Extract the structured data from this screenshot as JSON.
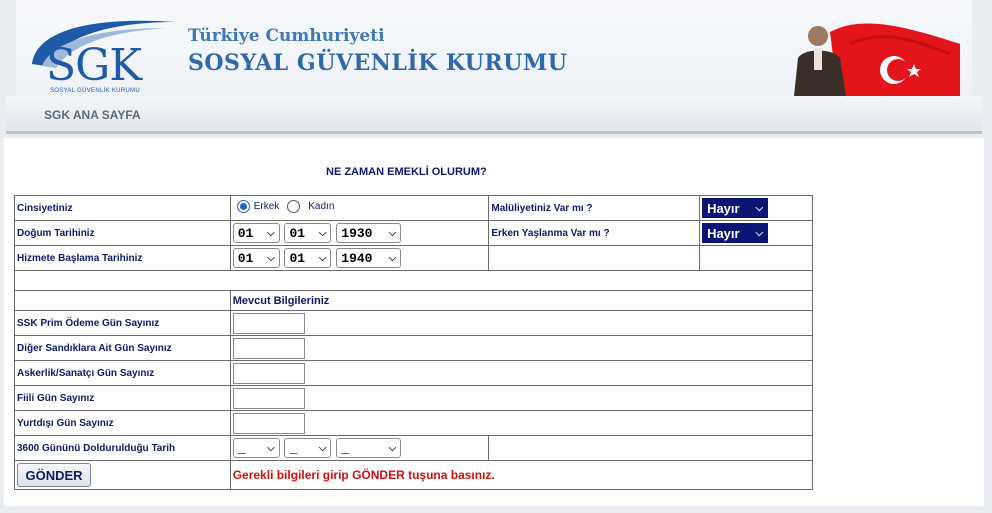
{
  "header": {
    "logo_text": "SGK",
    "logo_sub": "SOSYAL GÜVENLİK KURUMU",
    "title_line1": "Türkiye Cumhuriyeti",
    "title_line2": "SOSYAL GÜVENLİK KURUMU"
  },
  "nav": {
    "home_link": "SGK ANA SAYFA"
  },
  "page": {
    "title": "NE ZAMAN EMEKLİ OLURUM?",
    "gender": {
      "label": "Cinsiyetiniz",
      "male": "Erkek",
      "female": "Kadın",
      "selected": "Erkek"
    },
    "disability": {
      "label": "Malüliyetiniz Var mı ?",
      "value": "Hayır"
    },
    "birth": {
      "label": "Doğum Tarihiniz",
      "day": "01",
      "month": "01",
      "year": "1930"
    },
    "early_aging": {
      "label": "Erken Yaşlanma Var mı ?",
      "value": "Hayır"
    },
    "service_start": {
      "label": "Hizmete Başlama Tarihiniz",
      "day": "01",
      "month": "01",
      "year": "1940"
    },
    "current_info_heading": "Mevcut  Bilgileriniz",
    "fields": {
      "ssk_days": {
        "label": "SSK Prim Ödeme Gün Sayınız",
        "value": ""
      },
      "other_funds_days": {
        "label": "Diğer Sandıklara Ait Gün Sayınız",
        "value": ""
      },
      "military_days": {
        "label": "Askerlik/Sanatçı Gün Sayınız",
        "value": ""
      },
      "actual_days": {
        "label": "Fiili Gün Sayınız",
        "value": ""
      },
      "abroad_days": {
        "label": "Yurtdışı Gün Sayınız",
        "value": ""
      }
    },
    "completion_date": {
      "label": "3600 Gününü Doldurulduğu Tarih",
      "day": "_",
      "month": "_",
      "year": "_"
    },
    "submit_label": "GÖNDER",
    "instruction": "Gerekli bilgileri girip GÖNDER tuşuna basınız."
  },
  "colors": {
    "navy": "#0c1a6b",
    "accent_blue": "#2f69ad",
    "error_red": "#d01010"
  },
  "icons": {
    "dropdown": "chevron-down-icon",
    "flag": "turkish-flag-icon"
  }
}
